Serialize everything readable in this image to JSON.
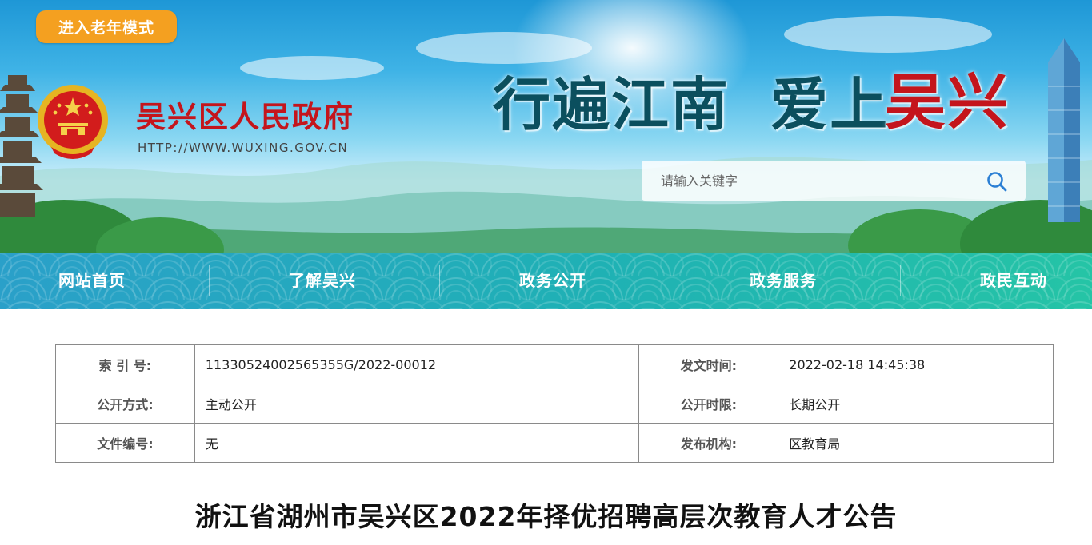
{
  "header": {
    "elder_mode_label": "进入老年模式",
    "site_name": "吴兴区人民政府",
    "site_url": "HTTP://WWW.WUXING.GOV.CN",
    "slogan_part1": "行遍江南",
    "slogan_part2": "爱上",
    "slogan_part3": "吴兴",
    "search": {
      "placeholder": "请输入关键字"
    }
  },
  "nav": {
    "items": [
      {
        "label": "网站首页"
      },
      {
        "label": "了解吴兴"
      },
      {
        "label": "政务公开"
      },
      {
        "label": "政务服务"
      },
      {
        "label": "政民互动"
      }
    ]
  },
  "info": {
    "rows": [
      {
        "label1": "索 引 号:",
        "value1": "11330524002565355G/2022-00012",
        "label2": "发文时间:",
        "value2": "2022-02-18 14:45:38"
      },
      {
        "label1": "公开方式:",
        "value1": "主动公开",
        "label2": "公开时限:",
        "value2": "长期公开"
      },
      {
        "label1": "文件编号:",
        "value1": "无",
        "label2": "发布机构:",
        "value2": "区教育局"
      }
    ]
  },
  "article": {
    "title": "浙江省湖州市吴兴区2022年择优招聘高层次教育人才公告"
  },
  "colors": {
    "brand_red": "#c4151c",
    "elder_button": "#f4a020",
    "nav_teal": "#1fb1b4"
  },
  "icons": {
    "search": "magnifier-icon",
    "emblem": "national-emblem-icon"
  }
}
